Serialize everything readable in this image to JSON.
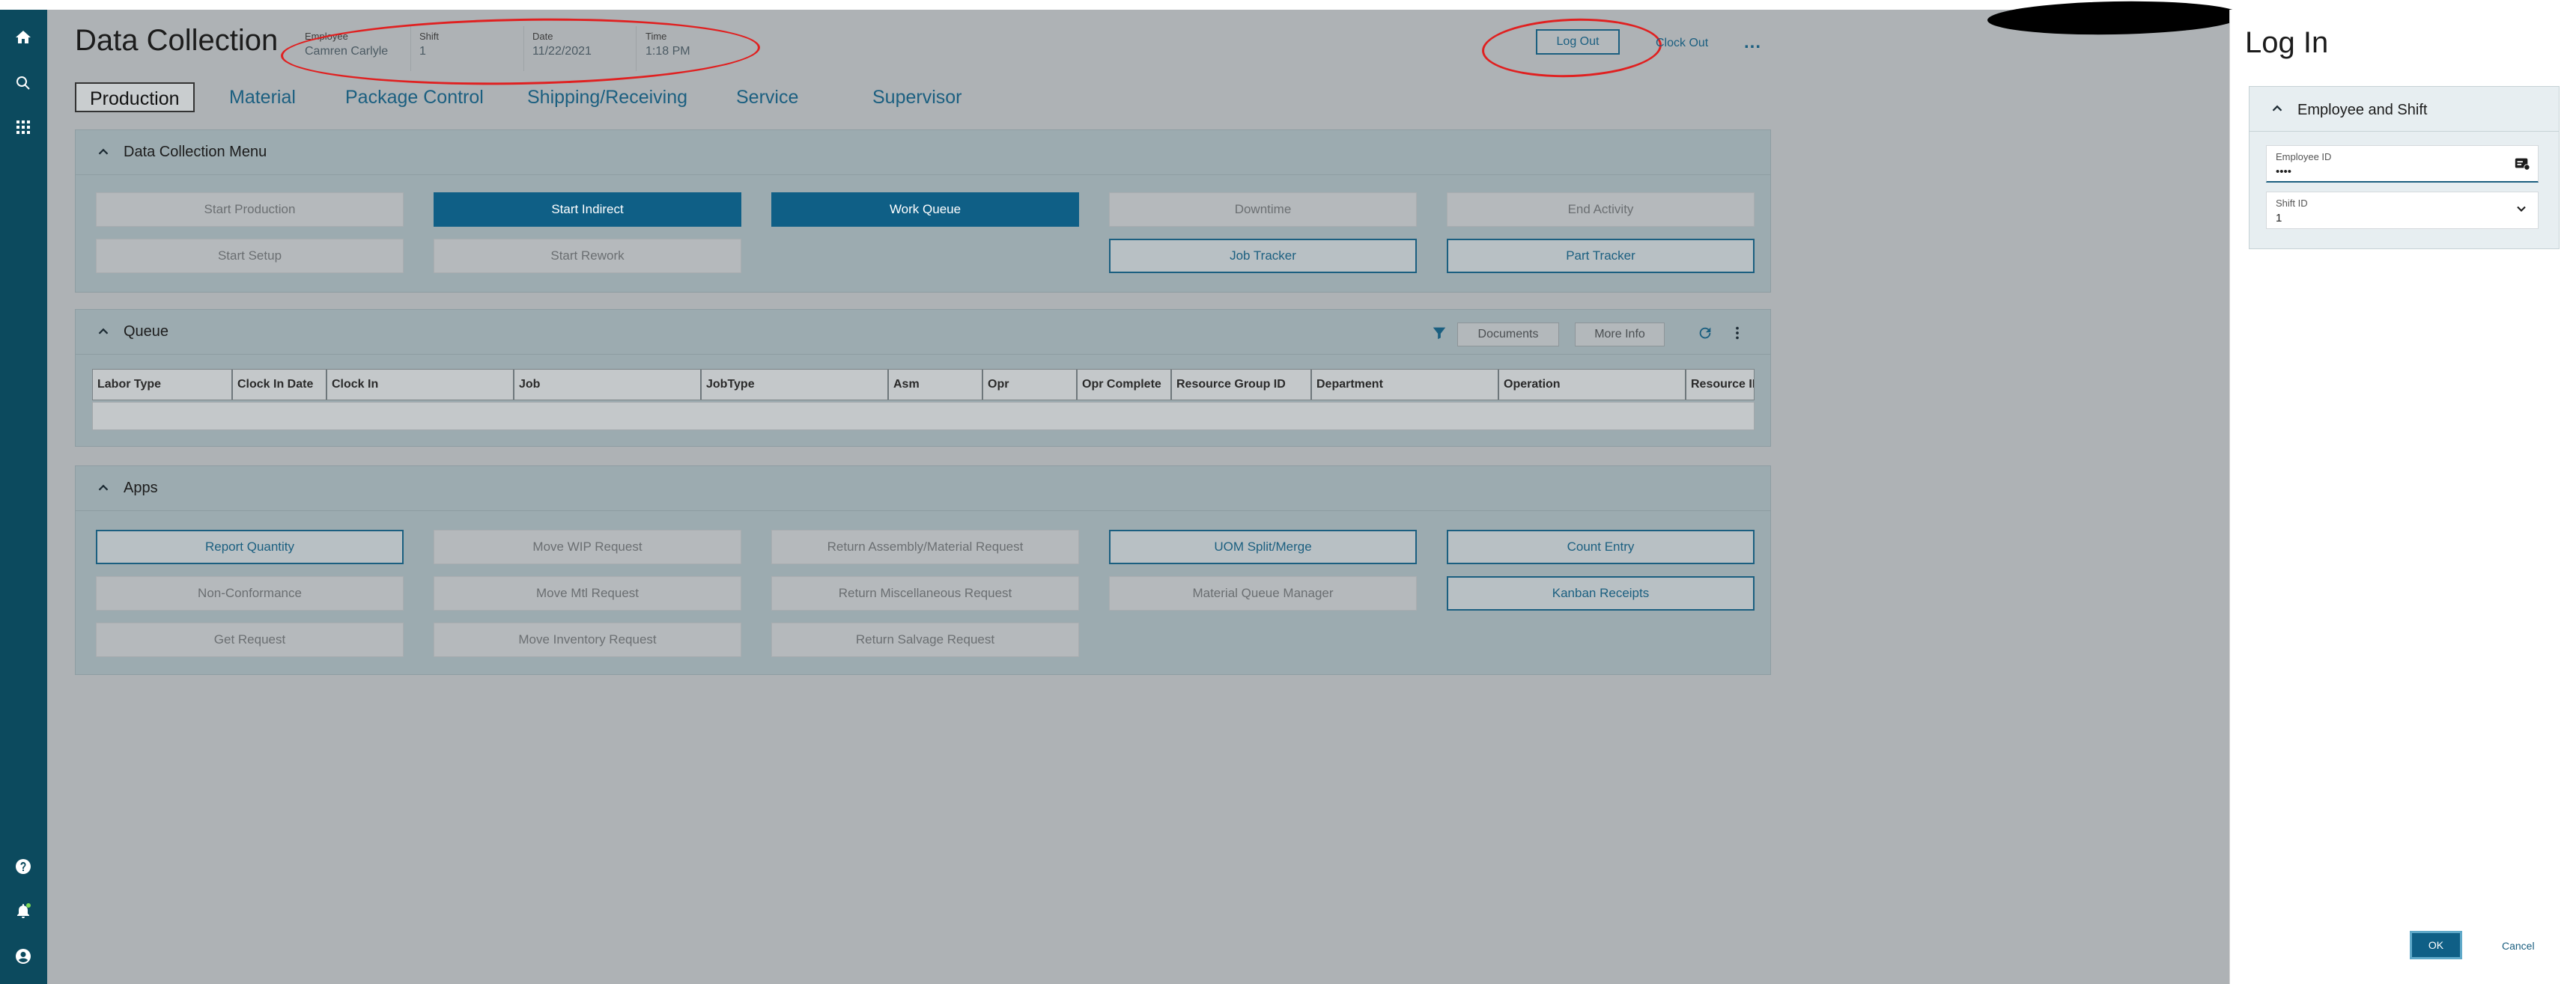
{
  "header": {
    "title": "Data Collection",
    "employee_label": "Employee",
    "employee_value": "Camren Carlyle",
    "shift_label": "Shift",
    "shift_value": "1",
    "date_label": "Date",
    "date_value": "11/22/2021",
    "time_label": "Time",
    "time_value": "1:18 PM",
    "logout_label": "Log Out",
    "clockout_label": "Clock Out",
    "more_label": "..."
  },
  "tabs": [
    {
      "label": "Production",
      "active": true
    },
    {
      "label": "Material"
    },
    {
      "label": "Package Control"
    },
    {
      "label": "Shipping/Receiving"
    },
    {
      "label": "Service"
    },
    {
      "label": "Supervisor"
    }
  ],
  "menu_panel": {
    "title": "Data Collection Menu",
    "buttons": [
      {
        "label": "Start Production",
        "state": "disabled"
      },
      {
        "label": "Start Indirect",
        "state": "primary"
      },
      {
        "label": "Work Queue",
        "state": "primary"
      },
      {
        "label": "Downtime",
        "state": "disabled"
      },
      {
        "label": "End Activity",
        "state": "disabled"
      },
      {
        "label": "Start Setup",
        "state": "disabled"
      },
      {
        "label": "Start Rework",
        "state": "disabled"
      },
      {
        "label": "Job Tracker",
        "state": "outline"
      },
      {
        "label": "Part Tracker",
        "state": "outline"
      }
    ]
  },
  "queue_panel": {
    "title": "Queue",
    "documents_label": "Documents",
    "more_info_label": "More Info",
    "columns": [
      "Labor Type",
      "Clock In Date",
      "Clock In",
      "Job",
      "JobType",
      "Asm",
      "Opr",
      "Opr Complete",
      "Resource Group ID",
      "Department",
      "Operation",
      "Resource ID"
    ]
  },
  "apps_panel": {
    "title": "Apps",
    "buttons": [
      {
        "label": "Report Quantity",
        "state": "outline"
      },
      {
        "label": "Move WIP Request",
        "state": "disabled"
      },
      {
        "label": "Return Assembly/Material Request",
        "state": "disabled"
      },
      {
        "label": "UOM Split/Merge",
        "state": "outline"
      },
      {
        "label": "Count Entry",
        "state": "outline"
      },
      {
        "label": "Non-Conformance",
        "state": "disabled"
      },
      {
        "label": "Move Mtl Request",
        "state": "disabled"
      },
      {
        "label": "Return Miscellaneous Request",
        "state": "disabled"
      },
      {
        "label": "Material Queue Manager",
        "state": "disabled"
      },
      {
        "label": "Kanban Receipts",
        "state": "outline"
      },
      {
        "label": "Get Request",
        "state": "disabled"
      },
      {
        "label": "Move Inventory Request",
        "state": "disabled"
      },
      {
        "label": "Return Salvage Request",
        "state": "disabled"
      }
    ]
  },
  "login_panel": {
    "title": "Log In",
    "section_title": "Employee and Shift",
    "employee_id_label": "Employee ID",
    "employee_id_value": "••••",
    "shift_id_label": "Shift ID",
    "shift_id_value": "1",
    "ok_label": "OK",
    "cancel_label": "Cancel"
  },
  "nav_icons": [
    "home-icon",
    "search-icon",
    "apps-grid-icon",
    "help-icon",
    "notifications-icon",
    "user-icon"
  ],
  "colors": {
    "accent": "#0f5f86",
    "nav": "#0c4a5e",
    "annotation": "#e02020"
  }
}
